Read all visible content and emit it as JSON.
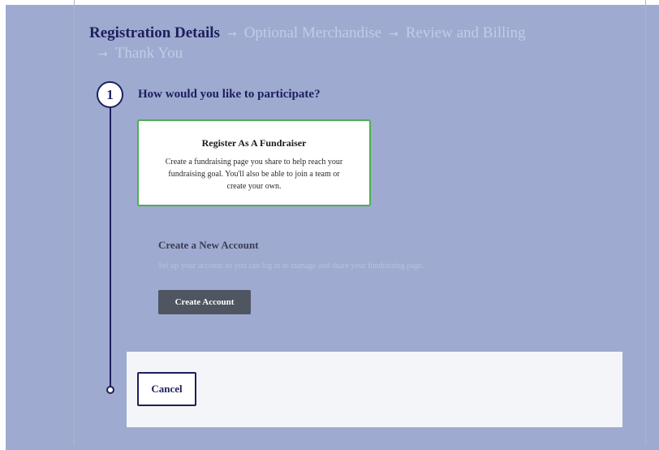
{
  "breadcrumb": {
    "steps": [
      {
        "label": "Registration Details",
        "active": true
      },
      {
        "label": "Optional Merchandise",
        "active": false
      },
      {
        "label": "Review and Billing",
        "active": false
      },
      {
        "label": "Thank You",
        "active": false
      }
    ],
    "separator_icon": "arrow-right-icon",
    "separator_glyph": "→"
  },
  "step": {
    "number": "1",
    "question": "How would you like to participate?"
  },
  "option": {
    "title": "Register As A Fundraiser",
    "description": "Create a fundraising page you share to help reach your fundraising goal. You'll also be able to join a team or create your own.",
    "selected": true
  },
  "account": {
    "title": "Create a New Account",
    "description": "Set up your account so you can log in to manage and share your fundraising page.",
    "button_label": "Create Account"
  },
  "footer": {
    "cancel_label": "Cancel"
  },
  "colors": {
    "background": "#9eaacf",
    "primary_navy": "#1e1f5e",
    "selected_border": "#4caf50",
    "button_dark": "#4f5661",
    "footer_panel": "#f3f5f8"
  }
}
